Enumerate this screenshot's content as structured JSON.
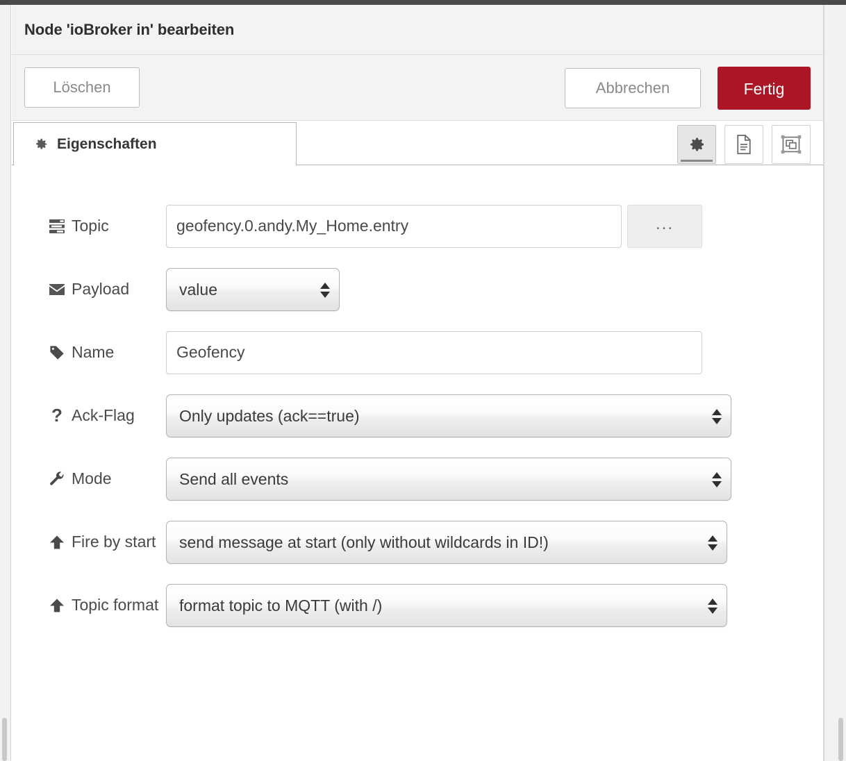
{
  "dialog": {
    "title": "Node 'ioBroker in' bearbeiten",
    "buttons": {
      "delete": "Löschen",
      "cancel": "Abbrechen",
      "done": "Fertig"
    },
    "accent_color": "#ad1625"
  },
  "tabs": [
    {
      "label": "Eigenschaften",
      "icon": "gear-icon",
      "active": true
    }
  ],
  "tab_icon_buttons": [
    {
      "name": "properties-gear-icon",
      "active": true
    },
    {
      "name": "description-document-icon",
      "active": false
    },
    {
      "name": "appearance-layout-icon",
      "active": false
    }
  ],
  "form": {
    "rows": [
      {
        "label": "Topic",
        "icon": "tasks-icon",
        "type": "text",
        "value": "geofency.0.andy.My_Home.entry",
        "placeholder": "",
        "extra_button": "..."
      },
      {
        "label": "Payload",
        "icon": "envelope-icon",
        "type": "select",
        "value": "value"
      },
      {
        "label": "Name",
        "icon": "tag-icon",
        "type": "text",
        "value": "Geofency",
        "placeholder": ""
      },
      {
        "label": "Ack-Flag",
        "icon": "question-icon",
        "type": "select",
        "value": "Only updates (ack==true)"
      },
      {
        "label": "Mode",
        "icon": "wrench-icon",
        "type": "select",
        "value": "Send all events"
      },
      {
        "label": "Fire by start",
        "icon": "arrow-up-icon",
        "type": "select",
        "value": "send message at start (only without wildcards in ID!)"
      },
      {
        "label": "Topic format",
        "icon": "arrow-up-icon",
        "type": "select",
        "value": "format topic to MQTT (with /)"
      }
    ]
  }
}
